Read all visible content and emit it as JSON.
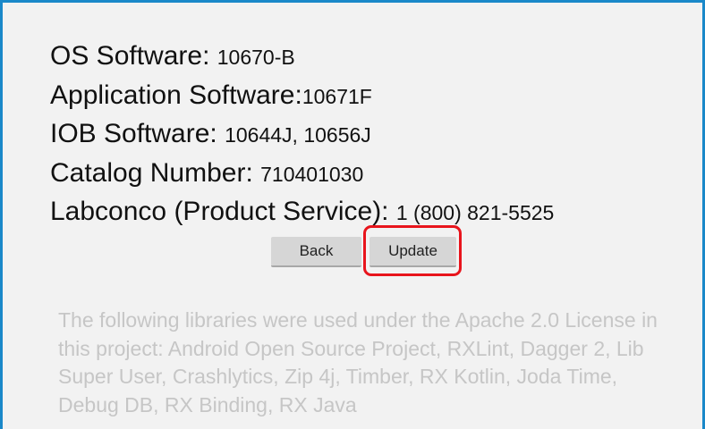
{
  "info": [
    {
      "label": "OS Software: ",
      "value": "10670-B"
    },
    {
      "label": "Application Software:",
      "value": "10671F"
    },
    {
      "label": "IOB Software: ",
      "value": "10644J, 10656J"
    },
    {
      "label": "Catalog Number: ",
      "value": "710401030"
    },
    {
      "label": "Labconco (Product Service): ",
      "value": "1 (800) 821-5525"
    }
  ],
  "buttons": {
    "back_label": "Back",
    "update_label": "Update"
  },
  "license_text": "The following libraries were used under the Apache 2.0 License in this project: Android Open Source Project, RXLint, Dagger 2, Lib Super User, Crashlytics, Zip 4j, Timber, RX Kotlin, Joda Time, Debug DB, RX Binding, RX Java",
  "colors": {
    "frame_border": "#1a88c9",
    "highlight": "#e8141c",
    "background": "#f2f2f2"
  }
}
